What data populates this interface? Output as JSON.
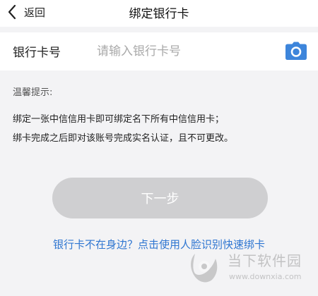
{
  "nav": {
    "back_label": "返回",
    "title": "绑定银行卡"
  },
  "card_field": {
    "label": "银行卡号",
    "value": "",
    "placeholder": "请输入银行卡号",
    "camera_icon": "camera-icon"
  },
  "tips": {
    "title": "温馨提示:",
    "lines": [
      "绑定一张中信信用卡即可绑定名下所有中信信用卡；",
      "绑卡完成之后即对该账号完成实名认证，且不可更改。"
    ]
  },
  "actions": {
    "next_label": "下一步",
    "face_link": "银行卡不在身边？点击使用人脸识别快速绑卡"
  },
  "watermark": {
    "title": "当下软件园",
    "url": "www.downxia.com"
  },
  "colors": {
    "background": "#f3f3f5",
    "accent": "#2f76d1",
    "button_disabled": "#cfcfd1",
    "text": "#222222",
    "placeholder": "#a9a9a9"
  }
}
